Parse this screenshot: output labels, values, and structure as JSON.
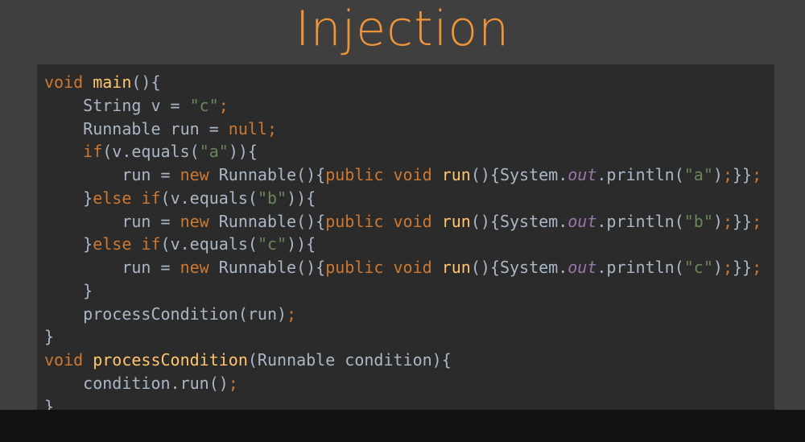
{
  "slide": {
    "title": "Injection"
  },
  "colors": {
    "background": "#3f3f3f",
    "code_background": "#2b2b2b",
    "title": "#f0943a",
    "bottom_bar": "#121212",
    "keyword": "#cc7832",
    "function": "#ffc66d",
    "string": "#6a8759",
    "field": "#9876aa",
    "plain": "#a9b7c6"
  },
  "code": {
    "lines": [
      [
        {
          "t": "void",
          "c": "kw"
        },
        {
          "t": " ",
          "c": "plain"
        },
        {
          "t": "main",
          "c": "fn"
        },
        {
          "t": "(){",
          "c": "plain"
        }
      ],
      [
        {
          "t": "    String v = ",
          "c": "plain"
        },
        {
          "t": "\"c\"",
          "c": "str"
        },
        {
          "t": ";",
          "c": "kw"
        }
      ],
      [
        {
          "t": "    Runnable run = ",
          "c": "plain"
        },
        {
          "t": "null",
          "c": "kw"
        },
        {
          "t": ";",
          "c": "kw"
        }
      ],
      [
        {
          "t": "    ",
          "c": "plain"
        },
        {
          "t": "if",
          "c": "kw"
        },
        {
          "t": "(v.equals(",
          "c": "plain"
        },
        {
          "t": "\"a\"",
          "c": "str"
        },
        {
          "t": ")){",
          "c": "plain"
        }
      ],
      [
        {
          "t": "        run = ",
          "c": "plain"
        },
        {
          "t": "new",
          "c": "kw"
        },
        {
          "t": " Runnable(){",
          "c": "plain"
        },
        {
          "t": "public",
          "c": "kw"
        },
        {
          "t": " ",
          "c": "plain"
        },
        {
          "t": "void",
          "c": "kw"
        },
        {
          "t": " ",
          "c": "plain"
        },
        {
          "t": "run",
          "c": "fn"
        },
        {
          "t": "(){System.",
          "c": "plain"
        },
        {
          "t": "out",
          "c": "field"
        },
        {
          "t": ".println(",
          "c": "plain"
        },
        {
          "t": "\"a\"",
          "c": "str"
        },
        {
          "t": ")",
          "c": "plain"
        },
        {
          "t": ";",
          "c": "kw"
        },
        {
          "t": "}}",
          "c": "plain"
        },
        {
          "t": ";",
          "c": "kw"
        }
      ],
      [
        {
          "t": "    }",
          "c": "plain"
        },
        {
          "t": "else",
          "c": "kw"
        },
        {
          "t": " ",
          "c": "plain"
        },
        {
          "t": "if",
          "c": "kw"
        },
        {
          "t": "(v.equals(",
          "c": "plain"
        },
        {
          "t": "\"b\"",
          "c": "str"
        },
        {
          "t": ")){",
          "c": "plain"
        }
      ],
      [
        {
          "t": "        run = ",
          "c": "plain"
        },
        {
          "t": "new",
          "c": "kw"
        },
        {
          "t": " Runnable(){",
          "c": "plain"
        },
        {
          "t": "public",
          "c": "kw"
        },
        {
          "t": " ",
          "c": "plain"
        },
        {
          "t": "void",
          "c": "kw"
        },
        {
          "t": " ",
          "c": "plain"
        },
        {
          "t": "run",
          "c": "fn"
        },
        {
          "t": "(){System.",
          "c": "plain"
        },
        {
          "t": "out",
          "c": "field"
        },
        {
          "t": ".println(",
          "c": "plain"
        },
        {
          "t": "\"b\"",
          "c": "str"
        },
        {
          "t": ")",
          "c": "plain"
        },
        {
          "t": ";",
          "c": "kw"
        },
        {
          "t": "}}",
          "c": "plain"
        },
        {
          "t": ";",
          "c": "kw"
        }
      ],
      [
        {
          "t": "    }",
          "c": "plain"
        },
        {
          "t": "else",
          "c": "kw"
        },
        {
          "t": " ",
          "c": "plain"
        },
        {
          "t": "if",
          "c": "kw"
        },
        {
          "t": "(v.equals(",
          "c": "plain"
        },
        {
          "t": "\"c\"",
          "c": "str"
        },
        {
          "t": ")){",
          "c": "plain"
        }
      ],
      [
        {
          "t": "        run = ",
          "c": "plain"
        },
        {
          "t": "new",
          "c": "kw"
        },
        {
          "t": " Runnable(){",
          "c": "plain"
        },
        {
          "t": "public",
          "c": "kw"
        },
        {
          "t": " ",
          "c": "plain"
        },
        {
          "t": "void",
          "c": "kw"
        },
        {
          "t": " ",
          "c": "plain"
        },
        {
          "t": "run",
          "c": "fn"
        },
        {
          "t": "(){System.",
          "c": "plain"
        },
        {
          "t": "out",
          "c": "field"
        },
        {
          "t": ".println(",
          "c": "plain"
        },
        {
          "t": "\"c\"",
          "c": "str"
        },
        {
          "t": ")",
          "c": "plain"
        },
        {
          "t": ";",
          "c": "kw"
        },
        {
          "t": "}}",
          "c": "plain"
        },
        {
          "t": ";",
          "c": "kw"
        }
      ],
      [
        {
          "t": "    }",
          "c": "plain"
        }
      ],
      [
        {
          "t": "    processCondition(run)",
          "c": "plain"
        },
        {
          "t": ";",
          "c": "kw"
        }
      ],
      [
        {
          "t": "}",
          "c": "plain"
        }
      ],
      [
        {
          "t": "void",
          "c": "kw"
        },
        {
          "t": " ",
          "c": "plain"
        },
        {
          "t": "processCondition",
          "c": "fn"
        },
        {
          "t": "(Runnable condition){",
          "c": "plain"
        }
      ],
      [
        {
          "t": "    condition.run()",
          "c": "plain"
        },
        {
          "t": ";",
          "c": "kw"
        }
      ],
      [
        {
          "t": "}",
          "c": "plain"
        }
      ]
    ]
  }
}
